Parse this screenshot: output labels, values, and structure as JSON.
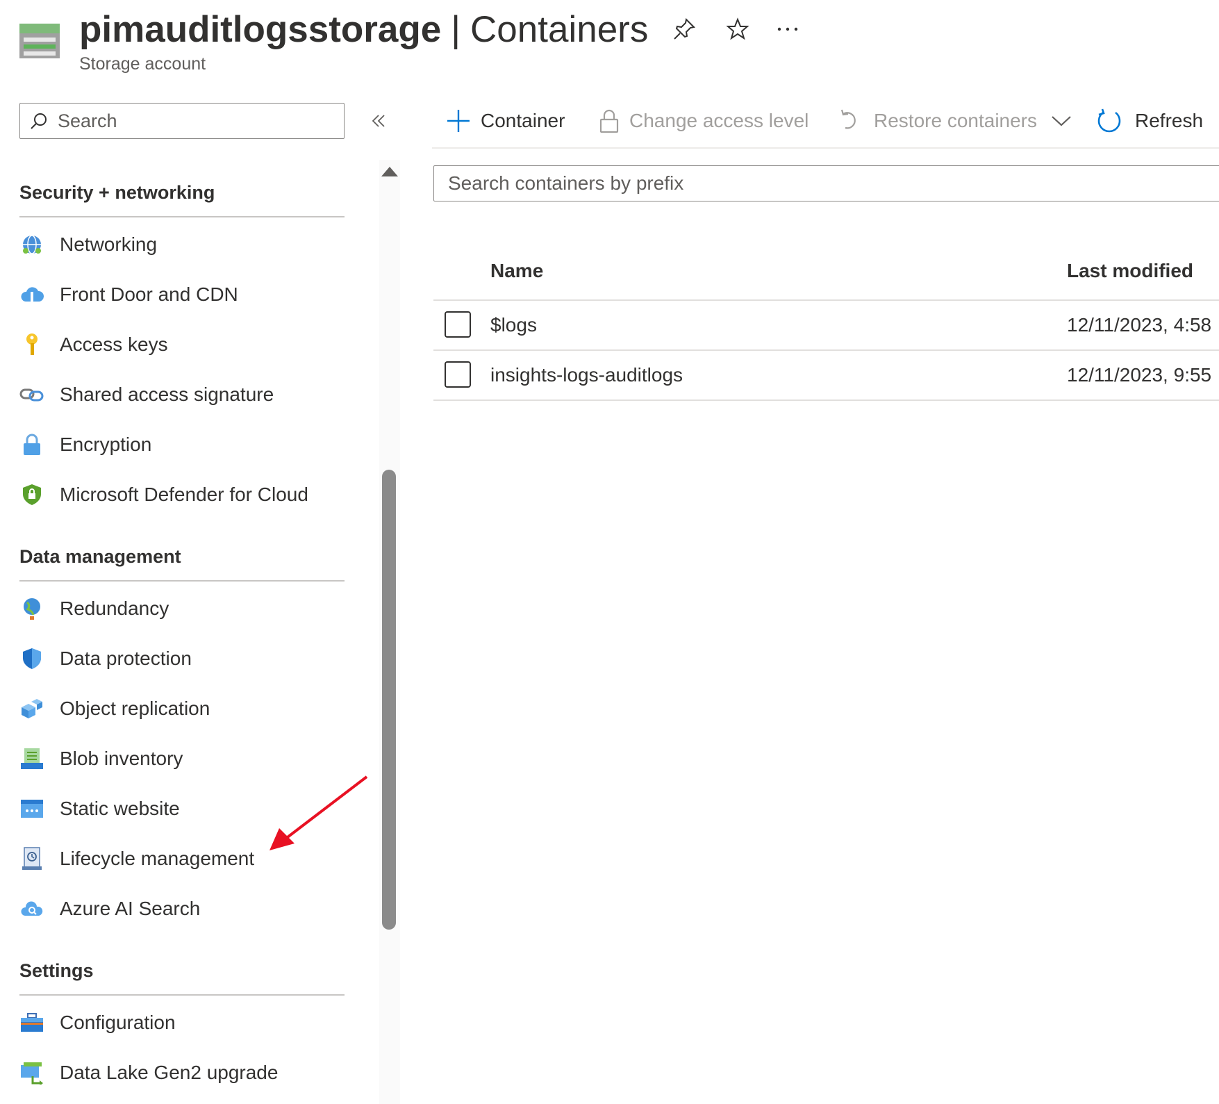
{
  "header": {
    "resource_name": "pimauditlogsstorage",
    "separator": "|",
    "section": "Containers",
    "subtitle": "Storage account",
    "icons": [
      "pin-icon",
      "star-icon",
      "more-icon"
    ]
  },
  "sidebar": {
    "search_placeholder": "Search",
    "collapse_icon": "double-chevron-left-icon",
    "groups": [
      {
        "title": "Security + networking",
        "items": [
          {
            "label": "Networking",
            "icon": "networking-icon"
          },
          {
            "label": "Front Door and CDN",
            "icon": "cloud-cdn-icon"
          },
          {
            "label": "Access keys",
            "icon": "key-icon"
          },
          {
            "label": "Shared access signature",
            "icon": "link-chain-icon"
          },
          {
            "label": "Encryption",
            "icon": "lock-icon"
          },
          {
            "label": "Microsoft Defender for Cloud",
            "icon": "defender-shield-icon"
          }
        ]
      },
      {
        "title": "Data management",
        "items": [
          {
            "label": "Redundancy",
            "icon": "globe-icon"
          },
          {
            "label": "Data protection",
            "icon": "shield-icon"
          },
          {
            "label": "Object replication",
            "icon": "cubes-icon"
          },
          {
            "label": "Blob inventory",
            "icon": "inventory-icon"
          },
          {
            "label": "Static website",
            "icon": "website-icon"
          },
          {
            "label": "Lifecycle management",
            "icon": "lifecycle-icon"
          },
          {
            "label": "Azure AI Search",
            "icon": "cloud-search-icon"
          }
        ]
      },
      {
        "title": "Settings",
        "items": [
          {
            "label": "Configuration",
            "icon": "toolbox-icon"
          },
          {
            "label": "Data Lake Gen2 upgrade",
            "icon": "upgrade-icon"
          }
        ]
      }
    ]
  },
  "toolbar": {
    "add_container": "Container",
    "change_access": "Change access level",
    "restore": "Restore containers",
    "refresh": "Refresh"
  },
  "prefix_search": {
    "placeholder": "Search containers by prefix"
  },
  "table": {
    "columns": [
      "Name",
      "Last modified"
    ],
    "rows": [
      {
        "name": "$logs",
        "modified": "12/11/2023, 4:58"
      },
      {
        "name": "insights-logs-auditlogs",
        "modified": "12/11/2023, 9:55"
      }
    ]
  },
  "colors": {
    "accent": "#0078d4",
    "annotation_arrow": "#e81123",
    "disabled_text": "#a19f9d"
  }
}
